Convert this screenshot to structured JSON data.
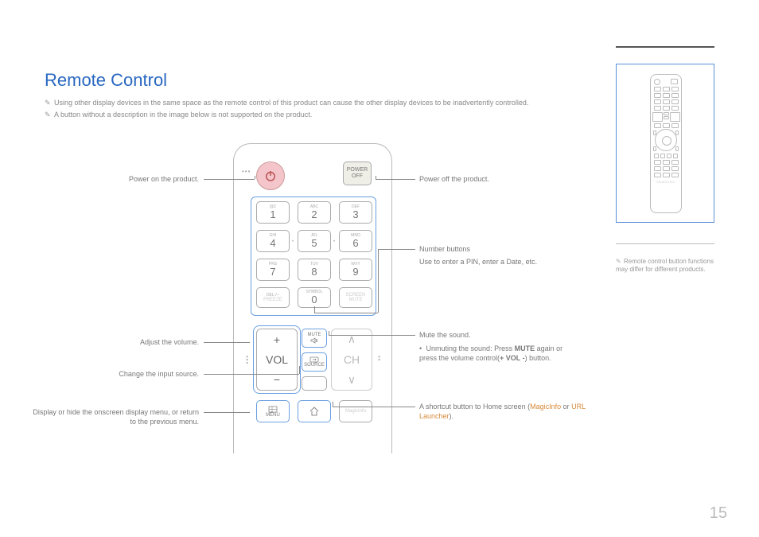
{
  "title": "Remote Control",
  "notes": {
    "n1": "Using other display devices in the same space as the remote control of this product can cause the other display devices to be inadvertently controlled.",
    "n2": "A button without a description in the image below is not supported on the product."
  },
  "remote": {
    "powerOff": "POWER\nOFF",
    "keypad": {
      "r1c1s": "@Z",
      "r1c1": "1",
      "r1c2s": "ABC",
      "r1c2": "2",
      "r1c3s": "DEF",
      "r1c3": "3",
      "r2c1s": "GHI",
      "r2c1": "4",
      "r2c2s": "JKL",
      "r2c2": "5",
      "r2c3s": "MNO",
      "r2c3": "6",
      "r3c1s": "PRS",
      "r3c1": "7",
      "r3c2s": "TUV",
      "r3c2": "8",
      "r3c3s": "WXY",
      "r3c3": "9",
      "r4c1s": "DEL-/--",
      "r4c1": "FREEZE",
      "r4c2s": "SYMBOL",
      "r4c2": "0",
      "r4c3s": "SCREEN",
      "r4c3": "MUTE"
    },
    "vol": "VOL",
    "ch": "CH",
    "mute": "MUTE",
    "source": "SOURCE",
    "menu": "MENU",
    "magicinfo": "MagicInfo"
  },
  "callouts": {
    "powerOn": "Power on the product.",
    "powerOff": "Power off the product.",
    "numHead": "Number buttons",
    "numBody": "Use to enter a PIN, enter a Date, etc.",
    "muteHead": "Mute the sound.",
    "muteBody1": "Unmuting the sound: Press ",
    "muteBold": "MUTE",
    "muteBody2": " again or press the volume control(",
    "muteBold2": "+ VOL -",
    "muteBody3": ") button.",
    "adjustVol": "Adjust the volume.",
    "changeSrc": "Change the input source.",
    "menu": "Display or hide the onscreen display menu, or return to the previous menu.",
    "shortcut1": "A shortcut button to Home screen (",
    "shortcutLink1": "MagicInfo",
    "shortcut2": " or ",
    "shortcutLink2": "URL Launcher",
    "shortcut3": ")."
  },
  "side": {
    "note": "Remote control button functions may differ for different products.",
    "brand": "SAMSUNG"
  },
  "pageNum": "15"
}
